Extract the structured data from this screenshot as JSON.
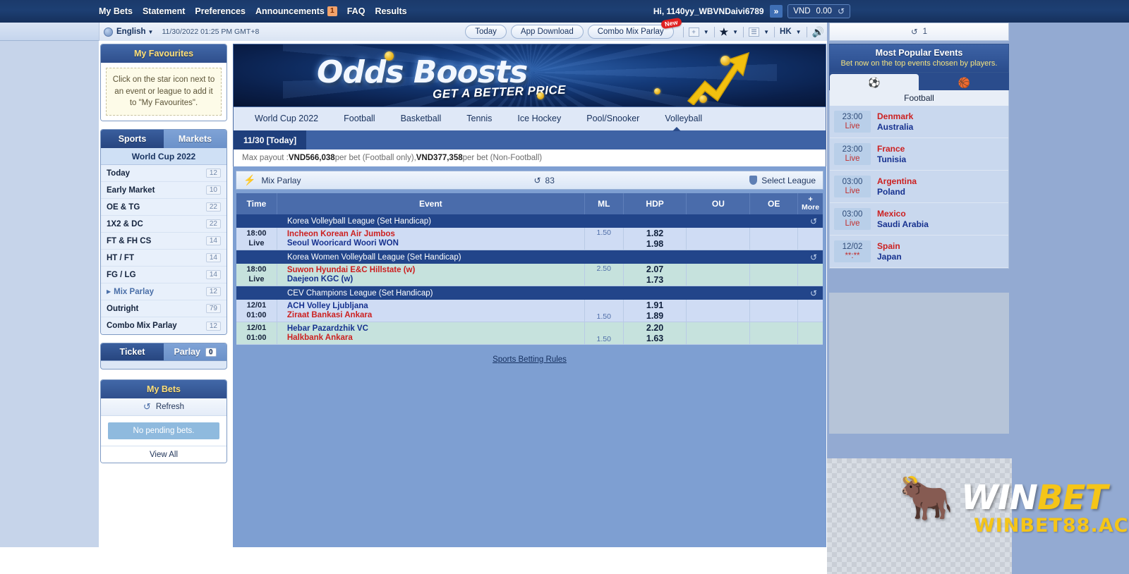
{
  "topnav": {
    "links": [
      {
        "label": "My Bets"
      },
      {
        "label": "Statement"
      },
      {
        "label": "Preferences"
      },
      {
        "label": "Announcements",
        "badge": "1"
      },
      {
        "label": "FAQ"
      },
      {
        "label": "Results"
      }
    ],
    "greeting": "Hi, 1140yy_WBVNDaivi6789",
    "expand_icon": "»",
    "currency": "VND",
    "balance": "0.00",
    "refresh_icon": "↺"
  },
  "subbar": {
    "language": "English",
    "caret": "▼",
    "datetime": "11/30/2022 01:25 PM GMT+8",
    "buttons": [
      {
        "label": "Today",
        "badge": ""
      },
      {
        "label": "App Download",
        "badge": ""
      },
      {
        "label": "Combo Mix Parlay",
        "badge": "New"
      }
    ],
    "tools": {
      "grid_icon": "+",
      "star_icon": "★",
      "list_icon": "☰",
      "odds_format": "HK",
      "sound_icon": "🔊",
      "caret": "▼"
    }
  },
  "sidebar": {
    "favourites": {
      "title": "My Favourites",
      "hint": "Click on the star icon next to an event or league to add it to \"My Favourites\"."
    },
    "tabs": [
      {
        "label": "Sports",
        "active": true
      },
      {
        "label": "Markets",
        "active": false
      }
    ],
    "section_title": "World Cup 2022",
    "items": [
      {
        "label": "Today",
        "count": "12"
      },
      {
        "label": "Early Market",
        "count": "10"
      },
      {
        "label": "OE & TG",
        "count": "22"
      },
      {
        "label": "1X2 & DC",
        "count": "22"
      },
      {
        "label": "FT & FH CS",
        "count": "14"
      },
      {
        "label": "HT / FT",
        "count": "14"
      },
      {
        "label": "FG / LG",
        "count": "14"
      },
      {
        "label": "Mix Parlay",
        "count": "12",
        "expandable": true,
        "arrow": "▶"
      },
      {
        "label": "Outright",
        "count": "79"
      },
      {
        "label": "Combo Mix Parlay",
        "count": "12"
      }
    ],
    "ticket_tabs": [
      {
        "label": "Ticket",
        "active": true,
        "count": ""
      },
      {
        "label": "Parlay",
        "active": false,
        "count": "0"
      }
    ],
    "mybets": {
      "title": "My Bets",
      "refresh_label": "Refresh",
      "refresh_icon": "↺",
      "empty_text": "No pending bets.",
      "viewall_label": "View All"
    }
  },
  "banner": {
    "title": "Odds Boosts",
    "subtitle": "GET A BETTER PRICE"
  },
  "main": {
    "sport_tabs": [
      {
        "label": "World Cup 2022",
        "active": false
      },
      {
        "label": "Football",
        "active": false
      },
      {
        "label": "Basketball",
        "active": false
      },
      {
        "label": "Tennis",
        "active": false
      },
      {
        "label": "Ice Hockey",
        "active": false
      },
      {
        "label": "Pool/Snooker",
        "active": false
      },
      {
        "label": "Volleyball",
        "active": true
      }
    ],
    "date_tag": "11/30 [Today]",
    "payout_prefix": "Max payout : ",
    "payout_amount1": "VND566,038",
    "payout_mid1": " per bet (Football only), ",
    "payout_amount2": "VND377,358",
    "payout_mid2": " per bet (Non-Football)",
    "mixbar": {
      "label": "Mix Parlay",
      "bolt_icon": "⚡",
      "counter_icon": "↺",
      "counter": "83",
      "select_league": "Select League",
      "shield_icon": "shield"
    },
    "columns": [
      {
        "key": "time",
        "label": "Time"
      },
      {
        "key": "event",
        "label": "Event"
      },
      {
        "key": "ml",
        "label": "ML"
      },
      {
        "key": "hdp",
        "label": "HDP"
      },
      {
        "key": "ou",
        "label": "OU"
      },
      {
        "key": "oe",
        "label": "OE"
      },
      {
        "key": "more",
        "label": "More",
        "plus": "+"
      }
    ],
    "leagues": [
      {
        "name": "Korea Volleyball League (Set Handicap)",
        "refresh_icon": "↺",
        "matches": [
          {
            "row_style": "odd",
            "time_line1": "18:00",
            "time_line2": "Live",
            "home": "Incheon Korean Air Jumbos",
            "away": "Seoul Wooricard Woori WON",
            "home_color": "red",
            "away_color": "blue",
            "ml_top": "1.50",
            "ml_bottom": "",
            "hdp_top": "1.82",
            "hdp_bottom": "1.98"
          }
        ]
      },
      {
        "name": "Korea Women Volleyball League (Set Handicap)",
        "refresh_icon": "↺",
        "matches": [
          {
            "row_style": "even",
            "time_line1": "18:00",
            "time_line2": "Live",
            "home": "Suwon Hyundai E&C Hillstate (w)",
            "away": "Daejeon KGC (w)",
            "home_color": "red",
            "away_color": "blue",
            "ml_top": "2.50",
            "ml_bottom": "",
            "hdp_top": "2.07",
            "hdp_bottom": "1.73"
          }
        ]
      },
      {
        "name": "CEV Champions League (Set Handicap)",
        "refresh_icon": "↺",
        "matches": [
          {
            "row_style": "odd",
            "time_line1": "12/01",
            "time_line2": "01:00",
            "home": "ACH Volley Ljubljana",
            "away": "Ziraat Bankasi Ankara",
            "home_color": "blue",
            "away_color": "red",
            "ml_top": "",
            "ml_bottom": "1.50",
            "hdp_top": "1.91",
            "hdp_bottom": "1.89"
          },
          {
            "row_style": "even",
            "time_line1": "12/01",
            "time_line2": "01:00",
            "home": "Hebar Pazardzhik VC",
            "away": "Halkbank Ankara",
            "home_color": "blue",
            "away_color": "red",
            "ml_top": "",
            "ml_bottom": "1.50",
            "hdp_top": "2.20",
            "hdp_bottom": "1.63"
          }
        ]
      }
    ],
    "rules_link": "Sports Betting Rules"
  },
  "rightpanel": {
    "refresh_icon": "↺",
    "refresh_count": "1",
    "title": "Most Popular Events",
    "subtitle": "Bet now on the top events chosen by players.",
    "sport_tabs": [
      {
        "icon": "⚽",
        "name": "football-icon",
        "active": true
      },
      {
        "icon": "🏀",
        "name": "basketball-icon",
        "active": false
      }
    ],
    "category": "Football",
    "events": [
      {
        "time": "23:00",
        "status": "Live",
        "home": "Denmark",
        "away": "Australia"
      },
      {
        "time": "23:00",
        "status": "Live",
        "home": "France",
        "away": "Tunisia"
      },
      {
        "time": "03:00",
        "status": "Live",
        "home": "Argentina",
        "away": "Poland"
      },
      {
        "time": "03:00",
        "status": "Live",
        "home": "Mexico",
        "away": "Saudi Arabia"
      },
      {
        "time": "12/02",
        "status": "**:**",
        "home": "Spain",
        "away": "Japan"
      }
    ]
  },
  "logo": {
    "bull_icon": "🐂",
    "win": "WIN",
    "bet": "BET",
    "domain": "WINBET88.AC"
  },
  "colors": {
    "accent_blue": "#2a4c8c",
    "home_red": "#cc2020",
    "away_blue": "#16318f",
    "gold": "#f5c518"
  }
}
